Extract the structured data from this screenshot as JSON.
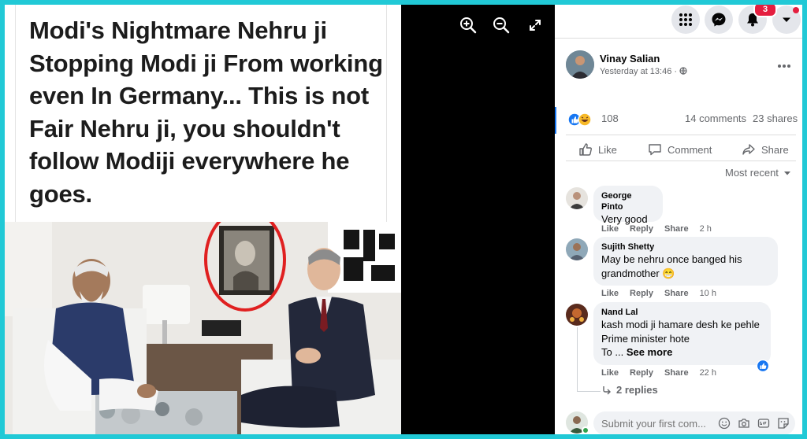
{
  "viewer": {
    "tools": [
      "zoom-in-icon",
      "zoom-out-icon",
      "fullscreen-icon"
    ],
    "caption": "Modi's Nightmare Nehru ji Stopping Modi ji From working even In Germany... This is not Fair Nehru ji, you shouldn't follow Modiji everywhere he goes."
  },
  "topbar": {
    "notifications_badge": "3"
  },
  "post": {
    "author": "Vinay Salian",
    "timestamp": "Yesterday at 13:46 ·",
    "reactions_count": "108",
    "comments_count": "14 comments",
    "shares_count": "23 shares",
    "actions": {
      "like": "Like",
      "comment": "Comment",
      "share": "Share"
    },
    "sort_label": "Most recent"
  },
  "comments": [
    {
      "name": "George Pinto",
      "text": "Very good",
      "like": "Like",
      "reply": "Reply",
      "share": "Share",
      "time": "2 h"
    },
    {
      "name": "Sujith Shetty",
      "text": "May be nehru once banged his grandmother 😁",
      "like": "Like",
      "reply": "Reply",
      "share": "Share",
      "time": "10 h"
    },
    {
      "name": "Nand Lal",
      "text": "kash modi ji hamare desh ke pehle Prime minister hote",
      "text2": "To ...",
      "see_more": "See more",
      "like": "Like",
      "reply": "Reply",
      "share": "Share",
      "time": "22 h",
      "replies": "2 replies"
    }
  ],
  "composer": {
    "placeholder": "Submit your first com..."
  },
  "colors": {
    "frame": "#21c9d6",
    "like_blue": "#1877f2",
    "annotation_red": "#e02020"
  }
}
